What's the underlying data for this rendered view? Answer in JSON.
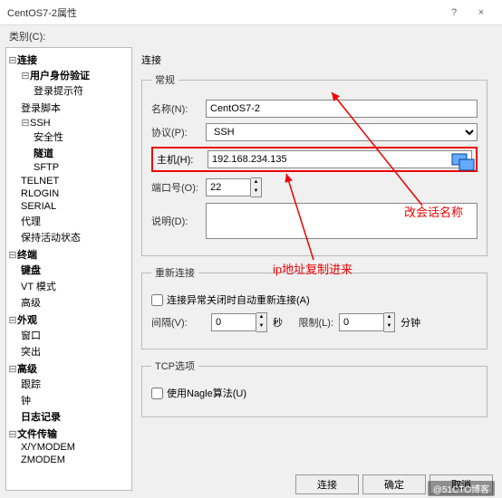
{
  "window": {
    "title": "CentOS7-2属性",
    "min": "?",
    "close": "×"
  },
  "category_label": "类别(C):",
  "tree": {
    "connection": "连接",
    "user_auth": "用户身份验证",
    "login_prompt": "登录提示符",
    "login_script": "登录脚本",
    "ssh": "SSH",
    "security": "安全性",
    "tunnel": "隧道",
    "sftp": "SFTP",
    "telnet": "TELNET",
    "rlogin": "RLOGIN",
    "serial": "SERIAL",
    "proxy": "代理",
    "keepalive": "保持活动状态",
    "terminal": "终端",
    "keyboard": "键盘",
    "vt": "VT 模式",
    "advanced": "高级",
    "appearance": "外观",
    "window": "窗口",
    "highlight": "突出",
    "advanced2": "高级",
    "trace": "跟踪",
    "bell": "钟",
    "logging": "日志记录",
    "transfer": "文件传输",
    "xymodem": "X/YMODEM",
    "zmodem": "ZMODEM"
  },
  "sections": {
    "conn": "连接",
    "general": "常规",
    "reconnect": "重新连接",
    "tcp": "TCP选项"
  },
  "fields": {
    "name_label": "名称(N):",
    "name_value": "CentOS7-2",
    "protocol_label": "协议(P):",
    "protocol_value": "SSH",
    "host_label": "主机(H):",
    "host_value": "192.168.234.135",
    "port_label": "端口号(O):",
    "port_value": "22",
    "desc_label": "说明(D):",
    "reconnect_chk": "连接异常关闭时自动重新连接(A)",
    "interval_label": "间隔(V):",
    "interval_value": "0",
    "sec": "秒",
    "limit_label": "限制(L):",
    "limit_value": "0",
    "min": "分钟",
    "nagle": "使用Nagle算法(U)"
  },
  "annotations": {
    "name": "改会话名称",
    "host": "ip地址复制进来"
  },
  "buttons": {
    "connect": "连接",
    "ok": "确定",
    "cancel": "取消"
  },
  "watermark": "@51CTO博客"
}
